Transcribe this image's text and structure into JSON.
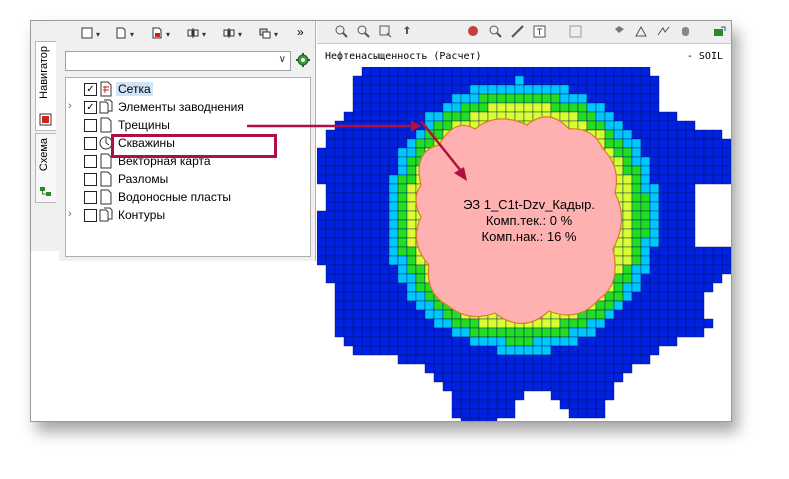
{
  "side_tabs": [
    {
      "label": "Навигатор",
      "icon": "navigator-icon"
    },
    {
      "label": "Схема",
      "icon": "scheme-icon"
    }
  ],
  "toolbar": {
    "more": "»"
  },
  "combo": {
    "value": ""
  },
  "close": "×",
  "tree": {
    "items": [
      {
        "label": "Сетка",
        "checked": true,
        "icon": "grid-layer-icon",
        "expandable": false,
        "selected": true
      },
      {
        "label": "Элементы заводнения",
        "checked": true,
        "icon": "flooding-layer-icon",
        "expandable": true,
        "selected": false
      },
      {
        "label": "Трещины",
        "checked": false,
        "icon": "layer-icon",
        "expandable": false,
        "selected": false
      },
      {
        "label": "Скважины",
        "checked": false,
        "icon": "wells-layer-icon",
        "expandable": false,
        "selected": false
      },
      {
        "label": "Векторная карта",
        "checked": false,
        "icon": "layer-icon",
        "expandable": false,
        "selected": false
      },
      {
        "label": "Разломы",
        "checked": false,
        "icon": "layer-icon",
        "expandable": false,
        "selected": false
      },
      {
        "label": "Водоносные пласты",
        "checked": false,
        "icon": "layer-icon",
        "expandable": false,
        "selected": false
      },
      {
        "label": "Контуры",
        "checked": false,
        "icon": "layer-icon",
        "expandable": true,
        "selected": false
      }
    ]
  },
  "map": {
    "title": "Нефтенасыщенность (Расчет)",
    "suffix": "- SOIL",
    "label_lines": [
      "ЭЗ 1_C1t-Dzv_Кадыр.",
      "Комп.тек.: 0 %",
      "Комп.нак.: 16 %"
    ]
  },
  "colors": {
    "blue": "#0022e0",
    "cyan": "#00c8ff",
    "green": "#22dd22",
    "yellow": "#d8ff30",
    "pink": "#ffb0b0",
    "highlight": "#b01040"
  }
}
